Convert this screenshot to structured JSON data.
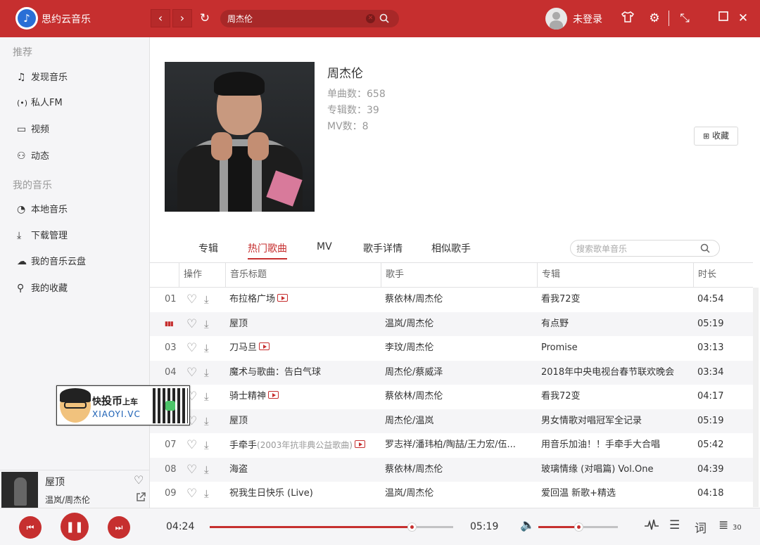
{
  "app": {
    "name": "思约云音乐"
  },
  "header": {
    "search_value": "周杰伦",
    "login_text": "未登录",
    "icons": [
      "back-arrow",
      "forward-arrow",
      "refresh",
      "clear",
      "search",
      "skin-shirt",
      "settings-gear",
      "mini-mode",
      "maximize",
      "close"
    ]
  },
  "sidebar": {
    "section1": "推荐",
    "items1": [
      {
        "label": "发现音乐",
        "icon": "music-note"
      },
      {
        "label": "私人FM",
        "icon": "radio"
      },
      {
        "label": "视频",
        "icon": "video"
      },
      {
        "label": "动态",
        "icon": "friends"
      }
    ],
    "section2": "我的音乐",
    "items2": [
      {
        "label": "本地音乐",
        "icon": "local-music"
      },
      {
        "label": "下载管理",
        "icon": "download"
      },
      {
        "label": "我的音乐云盘",
        "icon": "cloud"
      },
      {
        "label": "我的收藏",
        "icon": "collection"
      }
    ]
  },
  "now_playing": {
    "title": "屋顶",
    "artist": "温岚/周杰伦"
  },
  "artist": {
    "name": "周杰伦",
    "singles": "单曲数：658",
    "albums": "专辑数：39",
    "mvs": "MV数：8",
    "collect_label": "收藏"
  },
  "tabs": {
    "items": [
      "专辑",
      "热门歌曲",
      "MV",
      "歌手详情",
      "相似歌手"
    ],
    "active": "热门歌曲",
    "search_placeholder": "搜索歌单音乐"
  },
  "table": {
    "headers": [
      "操作",
      "音乐标题",
      "歌手",
      "专辑",
      "时长"
    ],
    "rows": [
      {
        "index": "01",
        "title": "布拉格广场",
        "subtitle": "",
        "mv": true,
        "singer": "蔡依林/周杰伦",
        "album": "看我72变",
        "duration": "04:54"
      },
      {
        "index": "",
        "playing": true,
        "title": "屋顶",
        "subtitle": "",
        "mv": false,
        "singer": "温岚/周杰伦",
        "album": "有点野",
        "duration": "05:19"
      },
      {
        "index": "03",
        "title": "刀马旦",
        "subtitle": "",
        "mv": true,
        "singer": "李玟/周杰伦",
        "album": "Promise",
        "duration": "03:13"
      },
      {
        "index": "04",
        "title": "魔术与歌曲：告白气球",
        "subtitle": "",
        "mv": false,
        "singer": "周杰伦/蔡威泽",
        "album": "2018年中央电视台春节联欢晚会",
        "duration": "03:34"
      },
      {
        "index": "05",
        "title": "骑士精神",
        "subtitle": "",
        "mv": true,
        "singer": "蔡依林/周杰伦",
        "album": "看我72变",
        "duration": "04:17"
      },
      {
        "index": "06",
        "title": "屋顶",
        "subtitle": "",
        "mv": false,
        "singer": "周杰伦/温岚",
        "album": "男女情歌对唱冠军全记录",
        "duration": "05:19"
      },
      {
        "index": "07",
        "title": "手牵手",
        "subtitle": "(2003年抗非典公益歌曲)",
        "mv": true,
        "singer": "罗志祥/潘玮柏/陶喆/王力宏/伍...",
        "album": "用音乐加油！！手牵手大合唱",
        "duration": "05:42"
      },
      {
        "index": "08",
        "title": "海盗",
        "subtitle": "",
        "mv": false,
        "singer": "蔡依林/周杰伦",
        "album": "玻璃情缘 (对唱篇) Vol.One",
        "duration": "04:39"
      },
      {
        "index": "09",
        "title": "祝我生日快乐 (Live)",
        "subtitle": "",
        "mv": false,
        "singer": "温岚/周杰伦",
        "album": "爱回温 新歌+精选",
        "duration": "04:18"
      }
    ]
  },
  "watermark": {
    "line1_a": "快",
    "line1_b": "投币",
    "line1_c": "上车",
    "line2": "XIAOYI.VC"
  },
  "player": {
    "current_time": "04:24",
    "total_time": "05:19",
    "progress": 0.83,
    "volume": 0.5,
    "playlist_count": "30",
    "lyric_label": "词",
    "accent": "#c62f2f"
  }
}
